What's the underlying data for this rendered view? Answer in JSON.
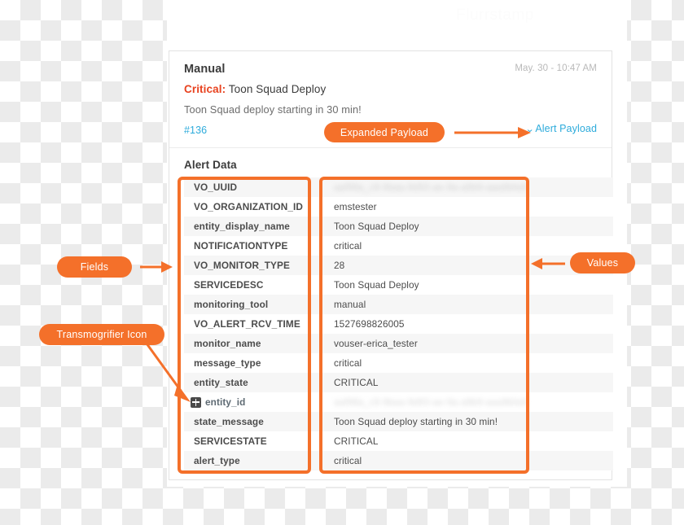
{
  "watermark": "Flurrstamp",
  "card": {
    "source_title": "Manual",
    "timestamp": "May. 30 - 10:47 AM",
    "severity_label": "Critical:",
    "severity_subject": "Toon Squad Deploy",
    "alert_message": "Toon Squad deploy starting in 30 min!",
    "alert_number": "#136",
    "payload_toggle_label": "Alert Payload",
    "payload_toggle_chevron": "⌄",
    "section_title": "Alert Data"
  },
  "table": {
    "rows": [
      {
        "field": "VO_UUID",
        "value": "",
        "redacted": true,
        "icon": false
      },
      {
        "field": "VO_ORGANIZATION_ID",
        "value": "emstester",
        "redacted": false,
        "icon": false
      },
      {
        "field": "entity_display_name",
        "value": "Toon Squad Deploy",
        "redacted": false,
        "icon": false
      },
      {
        "field": "NOTIFICATIONTYPE",
        "value": "critical",
        "redacted": false,
        "icon": false
      },
      {
        "field": "VO_MONITOR_TYPE",
        "value": "28",
        "redacted": false,
        "icon": false
      },
      {
        "field": "SERVICEDESC",
        "value": "Toon Squad Deploy",
        "redacted": false,
        "icon": false
      },
      {
        "field": "monitoring_tool",
        "value": "manual",
        "redacted": false,
        "icon": false
      },
      {
        "field": "VO_ALERT_RCV_TIME",
        "value": "1527698826005",
        "redacted": false,
        "icon": false
      },
      {
        "field": "monitor_name",
        "value": "vouser-erica_tester",
        "redacted": false,
        "icon": false
      },
      {
        "field": "message_type",
        "value": "critical",
        "redacted": false,
        "icon": false
      },
      {
        "field": "entity_state",
        "value": "CRITICAL",
        "redacted": false,
        "icon": false
      },
      {
        "field": "entity_id",
        "value": "",
        "redacted": true,
        "icon": true
      },
      {
        "field": "state_message",
        "value": "Toon Squad deploy starting in 30 min!",
        "redacted": false,
        "icon": false
      },
      {
        "field": "SERVICESTATE",
        "value": "CRITICAL",
        "redacted": false,
        "icon": false
      },
      {
        "field": "alert_type",
        "value": "critical",
        "redacted": false,
        "icon": false
      }
    ]
  },
  "annotations": {
    "expanded_payload": "Expanded Payload",
    "fields": "Fields",
    "transmogrifier_icon": "Transmogrifier Icon",
    "values": "Values"
  },
  "colors": {
    "accent_orange": "#f4702a",
    "critical_red": "#e8421f",
    "link_blue": "#2dabdb",
    "row_stripe": "#f6f6f6",
    "text_dark": "#3c3c3c",
    "text_muted": "#b9b9b9"
  }
}
